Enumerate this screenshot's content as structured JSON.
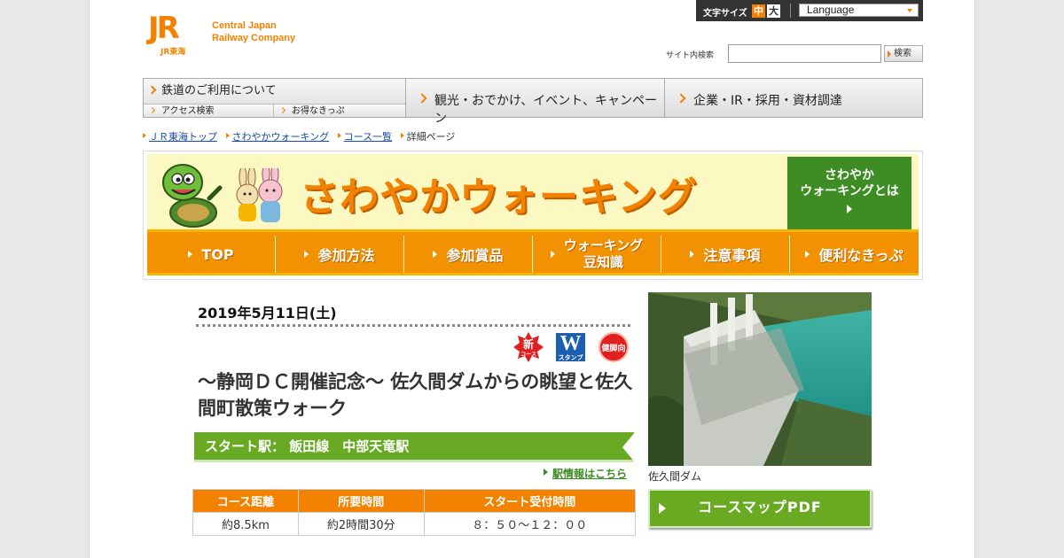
{
  "header": {
    "logo_mark": "JR",
    "logo_sub": "JR東海",
    "company_line1": "Central Japan",
    "company_line2": "Railway Company",
    "font_size_label": "文字サイズ",
    "font_size_medium": "中",
    "font_size_large": "大",
    "language_label": "Language",
    "search_label": "サイト内検索",
    "search_value": "",
    "search_button": "検索"
  },
  "global_nav": {
    "rail_main": "鉄道のご利用について",
    "rail_access": "アクセス検索",
    "rail_tickets": "お得なきっぷ",
    "travel": "観光・おでかけ、イベント、キャンペーン",
    "corporate": "企業・IR・採用・資材調達"
  },
  "breadcrumb": {
    "top": "ＪＲ東海トップ",
    "walking": "さわやかウォーキング",
    "course_list": "コース一覧",
    "current": "詳細ページ"
  },
  "banner": {
    "title": "さわやかウォーキング",
    "about_line1": "さわやか",
    "about_line2": "ウォーキングとは",
    "nav": [
      {
        "label": "TOP"
      },
      {
        "label": "参加方法"
      },
      {
        "label": "参加賞品"
      },
      {
        "label_line1": "ウォーキング",
        "label_line2": "豆知識"
      },
      {
        "label": "注意事項"
      },
      {
        "label": "便利なきっぷ"
      }
    ]
  },
  "event": {
    "date": "2019年5月11日(土)",
    "badge_new_line1": "新",
    "badge_new_line2": "コース",
    "badge_w": "W",
    "badge_w_sub": "スタンプ",
    "badge_health": "健脚向",
    "title": "～静岡ＤＣ開催記念～ 佐久間ダムからの眺望と佐久間町散策ウォーク",
    "start_station": "スタート駅：  飯田線　中部天竜駅",
    "station_link": "駅情報はこちら",
    "table": {
      "headers": [
        "コース距離",
        "所要時間",
        "スタート受付時間"
      ],
      "values": [
        "約8.5km",
        "約2時間30分",
        "８：５０～１２：００"
      ]
    },
    "photo_caption": "佐久間ダム",
    "pdf_button": "コースマップPDF"
  },
  "colors": {
    "brand_orange": "#f28200",
    "accent_green": "#68aa24",
    "banner_yellow": "#fbf8c2"
  }
}
